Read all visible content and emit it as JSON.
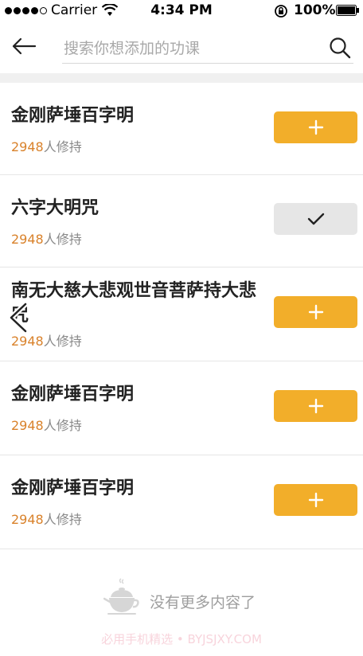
{
  "status_bar": {
    "carrier": "Carrier",
    "time": "4:34 PM",
    "battery": "100%"
  },
  "search": {
    "placeholder": "搜索你想添加的功课"
  },
  "courses": [
    {
      "title": "金刚萨埵百字明",
      "count": "2948",
      "suffix": "人修持",
      "state": "add"
    },
    {
      "title": "六字大明咒",
      "count": "2948",
      "suffix": "人修持",
      "state": "added"
    },
    {
      "title": "南无大慈大悲观世音菩萨持大悲咒",
      "count": "2948",
      "suffix": "人修持",
      "state": "add"
    },
    {
      "title": "金刚萨埵百字明",
      "count": "2948",
      "suffix": "人修持",
      "state": "add"
    },
    {
      "title": "金刚萨埵百字明",
      "count": "2948",
      "suffix": "人修持",
      "state": "add"
    }
  ],
  "footer": {
    "end_text": "没有更多内容了",
    "watermark": "必用手机精选 • BYJSJXY.COM"
  },
  "colors": {
    "accent": "#f2ae2a",
    "count": "#d9822b",
    "added_bg": "#e6e6e6"
  }
}
